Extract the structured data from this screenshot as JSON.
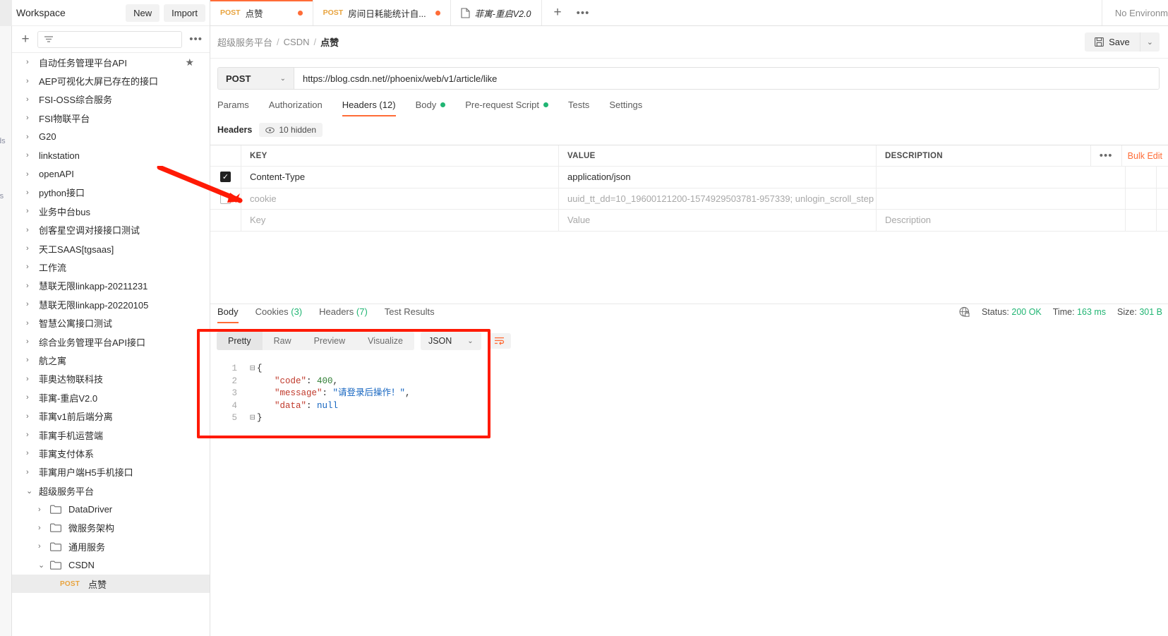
{
  "rail": {
    "labels": [
      "ds",
      "rs"
    ]
  },
  "workspace": {
    "title": "Workspace",
    "new_label": "New",
    "import_label": "Import",
    "filter_placeholder": "",
    "more_label": "•••"
  },
  "sidebar": {
    "items": [
      {
        "label": "自动任务管理平台API",
        "level": 1,
        "expanded": false,
        "starred": true
      },
      {
        "label": "AEP可视化大屏已存在的接口",
        "level": 1,
        "expanded": false,
        "starred": false
      },
      {
        "label": "FSI-OSS综合服务",
        "level": 1,
        "expanded": false,
        "starred": false
      },
      {
        "label": "FSI物联平台",
        "level": 1,
        "expanded": false,
        "starred": false
      },
      {
        "label": "G20",
        "level": 1,
        "expanded": false,
        "starred": false
      },
      {
        "label": "linkstation",
        "level": 1,
        "expanded": false,
        "starred": false
      },
      {
        "label": "openAPI",
        "level": 1,
        "expanded": false,
        "starred": false
      },
      {
        "label": "python接口",
        "level": 1,
        "expanded": false,
        "starred": false
      },
      {
        "label": "业务中台bus",
        "level": 1,
        "expanded": false,
        "starred": false
      },
      {
        "label": "创客星空调对接接口测试",
        "level": 1,
        "expanded": false,
        "starred": false
      },
      {
        "label": "天工SAAS[tgsaas]",
        "level": 1,
        "expanded": false,
        "starred": false
      },
      {
        "label": "工作流",
        "level": 1,
        "expanded": false,
        "starred": false
      },
      {
        "label": "慧联无限linkapp-20211231",
        "level": 1,
        "expanded": false,
        "starred": false
      },
      {
        "label": "慧联无限linkapp-20220105",
        "level": 1,
        "expanded": false,
        "starred": false
      },
      {
        "label": "智慧公寓接口测试",
        "level": 1,
        "expanded": false,
        "starred": false
      },
      {
        "label": "综合业务管理平台API接口",
        "level": 1,
        "expanded": false,
        "starred": false
      },
      {
        "label": "航之寓",
        "level": 1,
        "expanded": false,
        "starred": false
      },
      {
        "label": "菲奥达物联科技",
        "level": 1,
        "expanded": false,
        "starred": false
      },
      {
        "label": "菲寓-重启V2.0",
        "level": 1,
        "expanded": false,
        "starred": false
      },
      {
        "label": "菲寓v1前后端分离",
        "level": 1,
        "expanded": false,
        "starred": false
      },
      {
        "label": "菲寓手机运营端",
        "level": 1,
        "expanded": false,
        "starred": false
      },
      {
        "label": "菲寓支付体系",
        "level": 1,
        "expanded": false,
        "starred": false
      },
      {
        "label": "菲寓用户端H5手机接口",
        "level": 1,
        "expanded": false,
        "starred": false
      },
      {
        "label": "超级服务平台",
        "level": 1,
        "expanded": true,
        "starred": false
      },
      {
        "label": "DataDriver",
        "level": 2,
        "expanded": false,
        "folder": true
      },
      {
        "label": "微服务架构",
        "level": 2,
        "expanded": false,
        "folder": true
      },
      {
        "label": "通用服务",
        "level": 2,
        "expanded": false,
        "folder": true
      },
      {
        "label": "CSDN",
        "level": 2,
        "expanded": true,
        "folder": true
      },
      {
        "label": "点赞",
        "level": 3,
        "method": "POST",
        "selected": true
      }
    ]
  },
  "tabs": {
    "items": [
      {
        "method": "POST",
        "label": "点赞",
        "dirty": true,
        "active": true,
        "type": "request"
      },
      {
        "method": "POST",
        "label": "房间日耗能统计自...",
        "dirty": true,
        "active": false,
        "type": "request"
      },
      {
        "method": "",
        "label": "菲寓-重启V2.0",
        "dirty": false,
        "active": false,
        "type": "doc"
      }
    ],
    "add_label": "+",
    "more_label": "•••",
    "environment": "No Environm"
  },
  "breadcrumb": {
    "parts": [
      "超级服务平台",
      "CSDN",
      "点赞"
    ],
    "separator": "/"
  },
  "actions": {
    "save_label": "Save",
    "save_caret": "⌄"
  },
  "request": {
    "method": "POST",
    "url": "https://blog.csdn.net//phoenix/web/v1/article/like",
    "tabs": [
      {
        "label": "Params",
        "active": false,
        "dot": false
      },
      {
        "label": "Authorization",
        "active": false,
        "dot": false
      },
      {
        "label": "Headers (12)",
        "active": true,
        "dot": false
      },
      {
        "label": "Body",
        "active": false,
        "dot": true
      },
      {
        "label": "Pre-request Script",
        "active": false,
        "dot": true
      },
      {
        "label": "Tests",
        "active": false,
        "dot": false
      },
      {
        "label": "Settings",
        "active": false,
        "dot": false
      }
    ],
    "headers_label": "Headers",
    "hidden_label": "10 hidden",
    "table": {
      "columns": [
        "KEY",
        "VALUE",
        "DESCRIPTION"
      ],
      "bulk_edit_label": "Bulk Edit",
      "tools_label": "•••",
      "rows": [
        {
          "checked": true,
          "key": "Content-Type",
          "value": "application/json",
          "description": "",
          "placeholder": false
        },
        {
          "checked": false,
          "key": "cookie",
          "value": "uuid_tt_dd=10_19600121200-1574929503781-957339; unlogin_scroll_step",
          "description": "",
          "placeholder": false
        },
        {
          "checked": false,
          "key": "Key",
          "value": "Value",
          "description": "Description",
          "placeholder": true
        }
      ]
    }
  },
  "response": {
    "tabs": [
      {
        "label": "Body",
        "count": "",
        "active": true
      },
      {
        "label": "Cookies",
        "count": "(3)",
        "active": false
      },
      {
        "label": "Headers",
        "count": "(7)",
        "active": false
      },
      {
        "label": "Test Results",
        "count": "",
        "active": false
      }
    ],
    "status_label": "Status:",
    "status_value": "200 OK",
    "time_label": "Time:",
    "time_value": "163 ms",
    "size_label": "Size:",
    "size_value": "301 B",
    "viewer": {
      "modes": [
        {
          "label": "Pretty",
          "active": true
        },
        {
          "label": "Raw",
          "active": false
        },
        {
          "label": "Preview",
          "active": false
        },
        {
          "label": "Visualize",
          "active": false
        }
      ],
      "format": "JSON",
      "format_caret": "⌄",
      "wrap_icon": "wrap-lines-icon"
    },
    "body_lines": [
      {
        "no": "1",
        "fold": "⊟",
        "html": "<span class=\"pun\">{</span>"
      },
      {
        "no": "2",
        "fold": "",
        "html": "<span class=\"indent\"></span><span class=\"k\">\"code\"</span><span class=\"pun\">: </span><span class=\"num\">400</span><span class=\"pun\">,</span>"
      },
      {
        "no": "3",
        "fold": "",
        "html": "<span class=\"indent\"></span><span class=\"k\">\"message\"</span><span class=\"pun\">: </span><span class=\"str\">\"请登录后操作！\"</span><span class=\"pun\">,</span>"
      },
      {
        "no": "4",
        "fold": "",
        "html": "<span class=\"indent\"></span><span class=\"k\">\"data\"</span><span class=\"pun\">: </span><span class=\"nul\">null</span>"
      },
      {
        "no": "5",
        "fold": "⊟",
        "html": "<span class=\"pun\">}</span>"
      }
    ],
    "raw_body": "{ \"code\": 400, \"message\": \"请登录后操作！\", \"data\": null }"
  },
  "annotations": {
    "arrow_color": "#ff1a05",
    "box_color": "#ff1a05",
    "arrow_target": "cookie-row-checkbox",
    "box_target": "response-body-viewer"
  }
}
